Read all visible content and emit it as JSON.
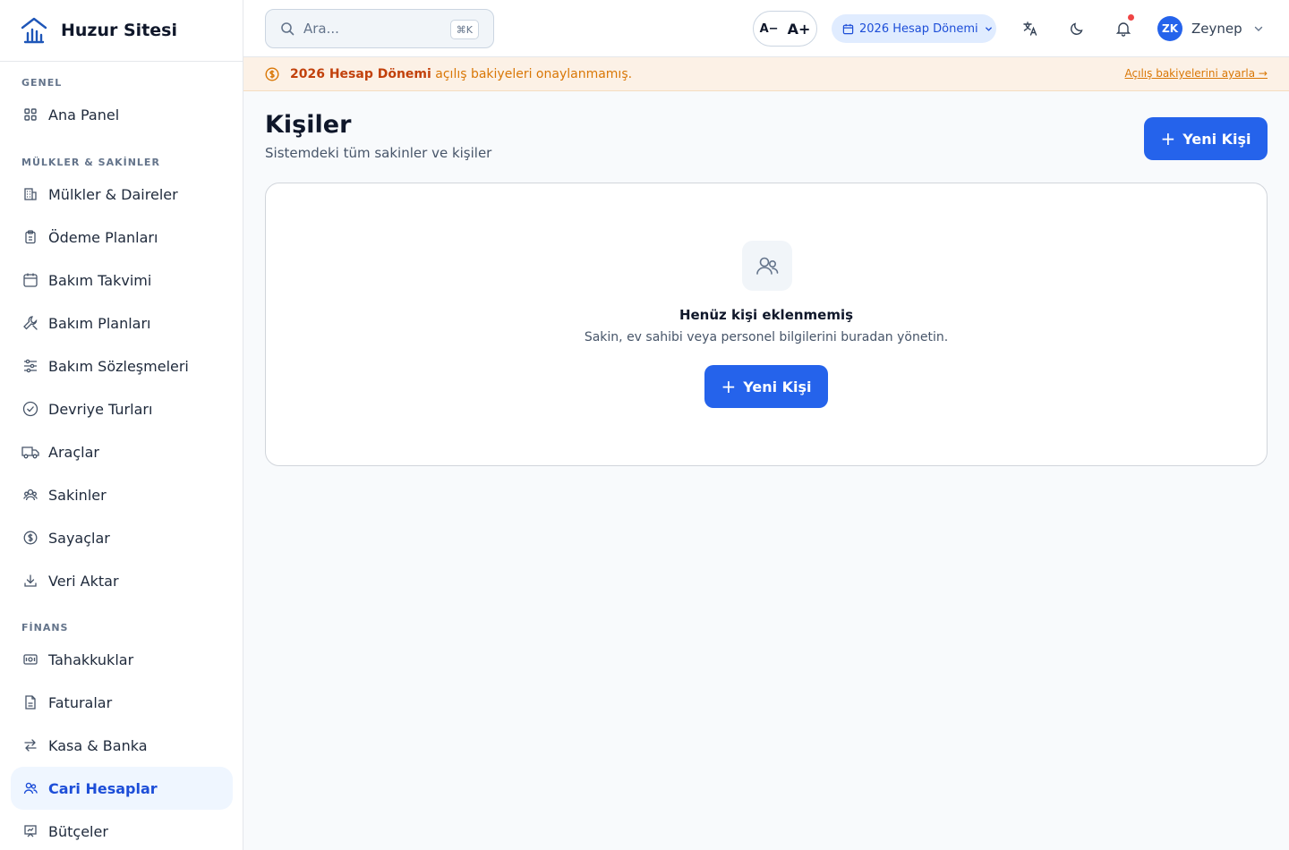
{
  "sidebar": {
    "brand": "Huzur Sitesi",
    "sections": [
      {
        "title": "GENEL",
        "items": [
          {
            "label": "Ana Panel",
            "icon": "grid-icon"
          }
        ]
      },
      {
        "title": "MÜLKLER & SAKİNLER",
        "items": [
          {
            "label": "Mülkler & Daireler",
            "icon": "building-icon"
          },
          {
            "label": "Ödeme Planları",
            "icon": "clipboard-icon"
          },
          {
            "label": "Bakım Takvimi",
            "icon": "calendar-icon"
          },
          {
            "label": "Bakım Planları",
            "icon": "wrench-icon"
          },
          {
            "label": "Bakım Sözleşmeleri",
            "icon": "sliders-icon"
          },
          {
            "label": "Devriye Turları",
            "icon": "check-circle-icon"
          },
          {
            "label": "Araçlar",
            "icon": "truck-icon"
          },
          {
            "label": "Sakinler",
            "icon": "users-icon"
          },
          {
            "label": "Sayaçlar",
            "icon": "dollar-circle-icon"
          },
          {
            "label": "Veri Aktar",
            "icon": "download-icon"
          }
        ]
      },
      {
        "title": "FİNANS",
        "items": [
          {
            "label": "Tahakkuklar",
            "icon": "banknote-icon"
          },
          {
            "label": "Faturalar",
            "icon": "file-icon"
          },
          {
            "label": "Kasa & Banka",
            "icon": "arrows-icon"
          },
          {
            "label": "Cari Hesaplar",
            "icon": "users-icon",
            "active": true
          },
          {
            "label": "Bütçeler",
            "icon": "presentation-icon"
          }
        ]
      }
    ]
  },
  "header": {
    "search_placeholder": "Ara...",
    "search_shortcut": "⌘K",
    "font_decrease": "A−",
    "font_increase": "A+",
    "period": "2026 Hesap Dönemi",
    "user_initials": "ZK",
    "user_name": "Zeynep"
  },
  "banner": {
    "strong": "2026 Hesap Dönemi",
    "text": " açılış bakiyeleri onaylanmamış.",
    "link": "Açılış bakiyelerini ayarla →"
  },
  "main": {
    "title": "Kişiler",
    "subtitle": "Sistemdeki tüm sakinler ve kişiler",
    "new_button": "Yeni Kişi",
    "empty_title": "Henüz kişi eklenmemiş",
    "empty_text": "Sakin, ev sahibi veya personel bilgilerini buradan yönetin.",
    "empty_button": "Yeni Kişi"
  },
  "colors": {
    "primary": "#2563eb",
    "active_bg": "#eff6ff",
    "warning": "#d97706",
    "banner_bg": "#fcf1e6"
  }
}
